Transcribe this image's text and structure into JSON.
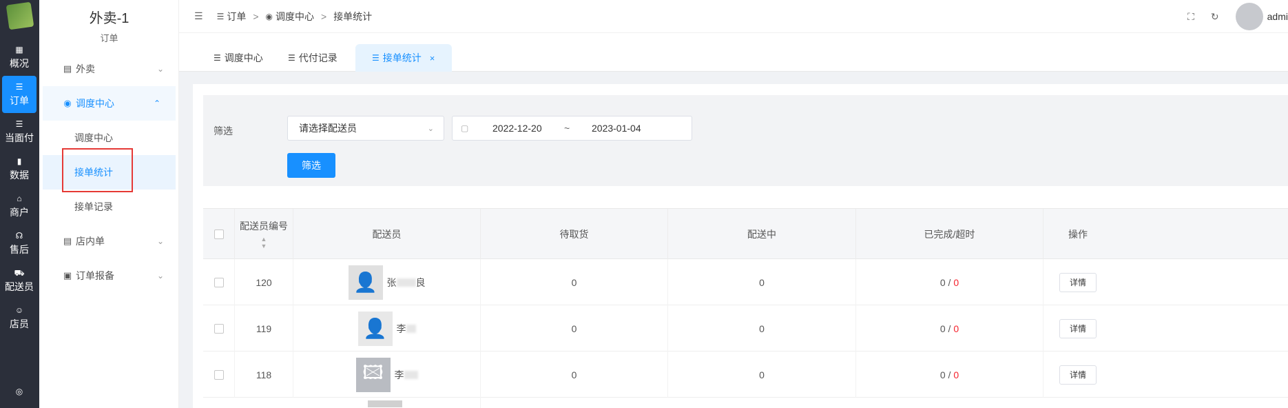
{
  "rail": {
    "items": [
      {
        "label": "概况",
        "icon": "dashboard-icon",
        "glyph": "▦"
      },
      {
        "label": "订单",
        "icon": "list-icon",
        "glyph": "☰"
      },
      {
        "label": "当面付",
        "icon": "list-icon",
        "glyph": "☰"
      },
      {
        "label": "数据",
        "icon": "bar-chart-icon",
        "glyph": "▮"
      },
      {
        "label": "商户",
        "icon": "store-icon",
        "glyph": "⌂"
      },
      {
        "label": "售后",
        "icon": "headset-icon",
        "glyph": "☊"
      },
      {
        "label": "配送员",
        "icon": "scooter-icon",
        "glyph": "⛟"
      },
      {
        "label": "店员",
        "icon": "users-icon",
        "glyph": "☺"
      },
      {
        "label": "",
        "icon": "user-circle-icon",
        "glyph": "◎"
      }
    ]
  },
  "sidebar": {
    "title": "外卖-1",
    "subtitle": "订单",
    "menu": [
      {
        "label": "外卖",
        "icon": "document-icon",
        "glyph": "▤"
      },
      {
        "label": "调度中心",
        "icon": "location-icon",
        "glyph": "◉"
      },
      {
        "label": "店内单",
        "icon": "document-icon",
        "glyph": "▤"
      },
      {
        "label": "订单报备",
        "icon": "file-icon",
        "glyph": "▣"
      }
    ],
    "submenu": [
      "调度中心",
      "接单统计",
      "接单记录"
    ]
  },
  "topbar": {
    "breadcrumb": [
      "订单",
      "调度中心",
      "接单统计"
    ],
    "admin_name": "admi"
  },
  "tabs": [
    {
      "label": "调度中心"
    },
    {
      "label": "代付记录"
    },
    {
      "label": "接单统计",
      "close": "×"
    }
  ],
  "filter": {
    "label": "筛选",
    "select_placeholder": "请选择配送员",
    "date_start": "2022-12-20",
    "date_sep": "~",
    "date_end": "2023-01-04",
    "button": "筛选"
  },
  "table": {
    "columns": [
      "配送员编号",
      "配送员",
      "待取货",
      "配送中",
      "已完成/超时",
      "操作"
    ],
    "rows": [
      {
        "id": "120",
        "name": "张",
        "name_tail": "良",
        "pending": "0",
        "delivering": "0",
        "completed": "0",
        "overtime": "0",
        "action": "详情"
      },
      {
        "id": "119",
        "name": "李",
        "name_tail": "",
        "pending": "0",
        "delivering": "0",
        "completed": "0",
        "overtime": "0",
        "action": "详情"
      },
      {
        "id": "118",
        "name": "李",
        "name_tail": "",
        "pending": "0",
        "delivering": "0",
        "completed": "0",
        "overtime": "0",
        "action": "详情"
      }
    ]
  },
  "colors": {
    "accent": "#1890ff",
    "rail_bg": "#2b2f3a",
    "danger": "#f5222d"
  }
}
